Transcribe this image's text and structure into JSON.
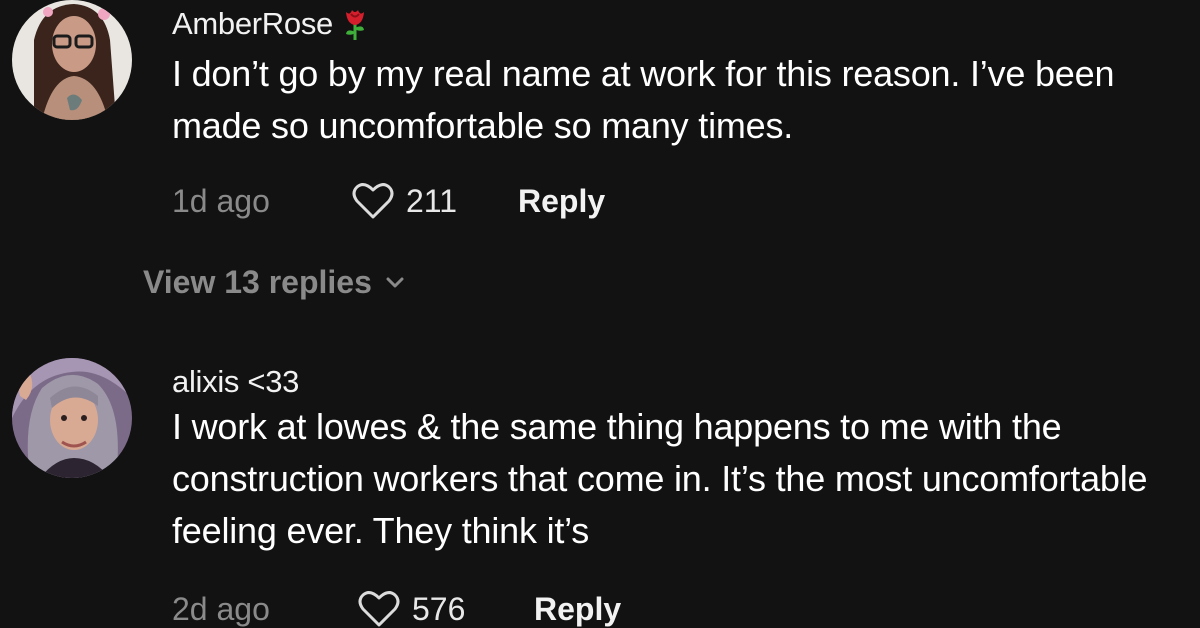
{
  "comments": [
    {
      "username": "AmberRose",
      "text": "I don’t go by my real name at work for this reason. I’ve been made so uncomfortable so many times.",
      "time": "1d ago",
      "likes": "211",
      "reply_label": "Reply",
      "view_replies": "View 13 replies"
    },
    {
      "username": "alixis <33",
      "text": "I work at lowes & the same thing happens to me with the construction workers that come in. It’s the most uncomfortable feeling ever. They think it’s",
      "time": "2d ago",
      "likes": "576",
      "reply_label": "Reply"
    }
  ],
  "icons": {
    "username_emoji": "rose-icon",
    "like": "heart-icon",
    "expand": "chevron-down-icon"
  },
  "colors": {
    "background": "#121212",
    "primary_text": "#ffffff",
    "secondary_text": "#8a8a8a"
  }
}
